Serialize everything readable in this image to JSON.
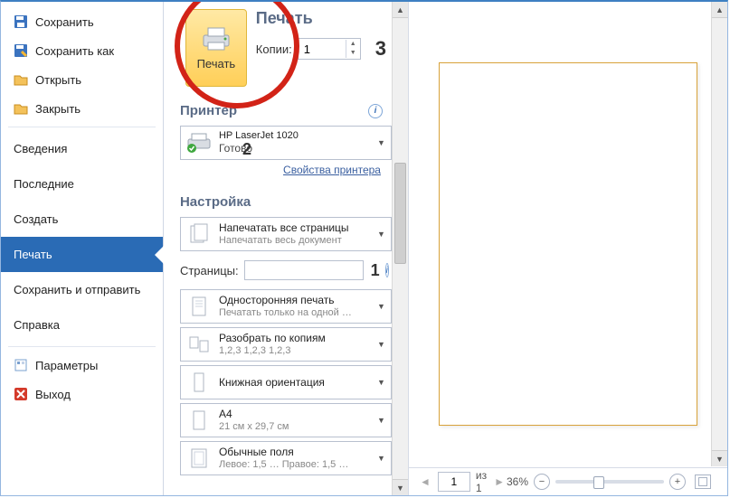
{
  "annotations": {
    "n1": "1",
    "n2": "2",
    "n3": "3"
  },
  "sidebar": {
    "save": "Сохранить",
    "save_as": "Сохранить как",
    "open": "Открыть",
    "close": "Закрыть",
    "info": "Сведения",
    "recent": "Последние",
    "new": "Создать",
    "print": "Печать",
    "save_send": "Сохранить и отправить",
    "help": "Справка",
    "options": "Параметры",
    "exit": "Выход"
  },
  "print": {
    "button_label": "Печать",
    "heading": "Печать",
    "copies_label": "Копии:",
    "copies_value": "1",
    "printer_heading": "Принтер",
    "printer_name": "HP LaserJet 1020",
    "printer_status": "Готово",
    "printer_props": "Свойства принтера",
    "settings_heading": "Настройка",
    "pages_label": "Страницы:",
    "pages_value": "",
    "settings": [
      {
        "line1": "Напечатать все страницы",
        "line2": "Напечатать весь документ"
      },
      {
        "line1": "Односторонняя печать",
        "line2": "Печатать только на одной …"
      },
      {
        "line1": "Разобрать по копиям",
        "line2": "1,2,3   1,2,3   1,2,3"
      },
      {
        "line1": "Книжная ориентация",
        "line2": ""
      },
      {
        "line1": "A4",
        "line2": "21 см x 29,7 см"
      },
      {
        "line1": "Обычные поля",
        "line2": "Левое: 1,5 …  Правое: 1,5 …"
      }
    ]
  },
  "preview": {
    "page": "1",
    "page_total": "из 1",
    "zoom": "36%"
  }
}
